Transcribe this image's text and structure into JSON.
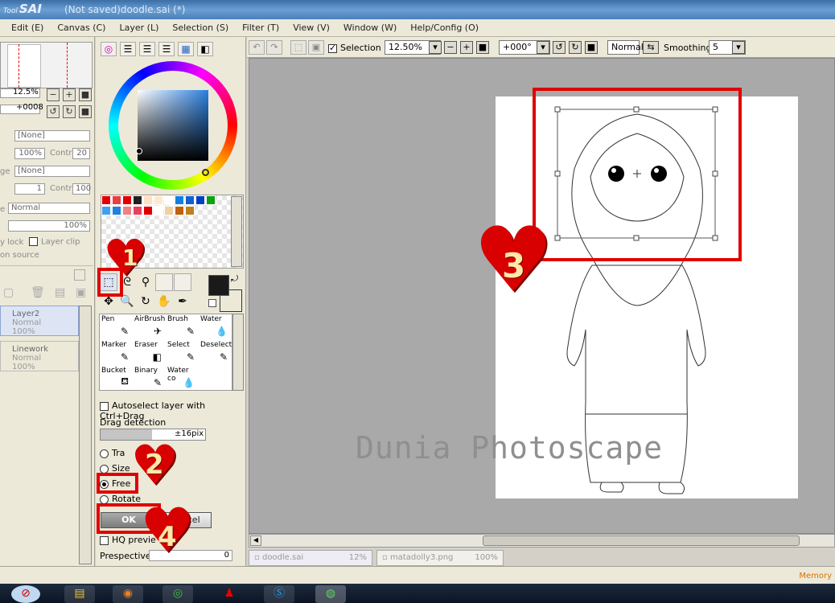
{
  "window": {
    "logo": "SAI",
    "logo_prefix": "Tool",
    "title": "(Not saved)doodle.sai (*)"
  },
  "menu": [
    {
      "label": "Edit (E)"
    },
    {
      "label": "Canvas (C)"
    },
    {
      "label": "Layer (L)"
    },
    {
      "label": "Selection (S)"
    },
    {
      "label": "Filter (T)"
    },
    {
      "label": "View (V)"
    },
    {
      "label": "Window (W)"
    },
    {
      "label": "Help/Config (O)"
    }
  ],
  "navigator": {
    "zoom": "12.5%",
    "angle": "+0008"
  },
  "left_panel": {
    "none_1": "[None]",
    "opacity_1": "100%",
    "contr_1_label": "Contr",
    "contr_1_value": "20",
    "blend_label_frag": "ge",
    "none_2": "[None]",
    "value_2": "1",
    "contr_2_label": "Contr",
    "contr_2_value": "100",
    "mode_label_frag": "e",
    "mode": "Normal",
    "opacity": "100%",
    "lock_frag": "y lock",
    "layer_clip": "Layer clip",
    "source_frag": "on source",
    "layers": [
      {
        "name": "Layer2",
        "mode": "Normal",
        "opacity": "100%"
      },
      {
        "name": "Linework",
        "mode": "Normal",
        "opacity": "100%"
      }
    ]
  },
  "colors": {
    "swatches_row1": [
      "#e00000",
      "#e84040",
      "#e00000",
      "#202020",
      "#ffe0c0",
      "#ffe8d0",
      "#ffffff",
      "#1080e0",
      "#1060d0",
      "#0040c0",
      "#10a010"
    ],
    "swatches_row2": [
      "#40a0f0",
      "#2080e0",
      "#f08080",
      "#e84060",
      "#e00000",
      "#ffffff",
      "#f0d0a0",
      "#c06010",
      "#c08020"
    ],
    "primary": "#1a1a1a",
    "secondary": "#ffffff"
  },
  "tools": [
    {
      "label": "Pen",
      "icon": "✎"
    },
    {
      "label": "AirBrush",
      "icon": "✈"
    },
    {
      "label": "Brush",
      "icon": "✎"
    },
    {
      "label": "Water",
      "icon": "💧"
    },
    {
      "label": "Marker",
      "icon": "✎"
    },
    {
      "label": "Eraser",
      "icon": "◧"
    },
    {
      "label": "Select",
      "icon": "✎"
    },
    {
      "label": "Deselect",
      "icon": "✎"
    },
    {
      "label": "Bucket",
      "icon": "⛾"
    },
    {
      "label": "Binary",
      "icon": "✎"
    },
    {
      "label": "Water co",
      "icon": "💧"
    }
  ],
  "transform": {
    "autoselect": "Autoselect layer with Ctrl+Drag",
    "drag_detection_label": "Drag detection",
    "drag_detection_value": "±16pix",
    "options": [
      {
        "label": "Tra",
        "suffix": "n"
      },
      {
        "label": "Size"
      },
      {
        "label": "Free",
        "selected": true
      },
      {
        "label": "Rotate"
      }
    ],
    "ok": "OK",
    "cancel": "Cancel",
    "hq_preview": "HQ previe",
    "perspective_label": "Prespective",
    "perspective_value": "0"
  },
  "canvas_toolbar": {
    "selection_label": "Selection",
    "zoom": "12.50%",
    "angle": "+000°",
    "blend": "Normal",
    "smoothing_label": "Smoothing",
    "smoothing_value": "5"
  },
  "canvas": {
    "watermark": "Dunia Photoscape"
  },
  "annotations": [
    "1",
    "2",
    "3",
    "4"
  ],
  "file_tabs": [
    {
      "name": "doodle.sai",
      "zoom": "12%"
    },
    {
      "name": "matadolly3.png",
      "zoom": "100%"
    }
  ],
  "status": {
    "memory": "Memory"
  }
}
